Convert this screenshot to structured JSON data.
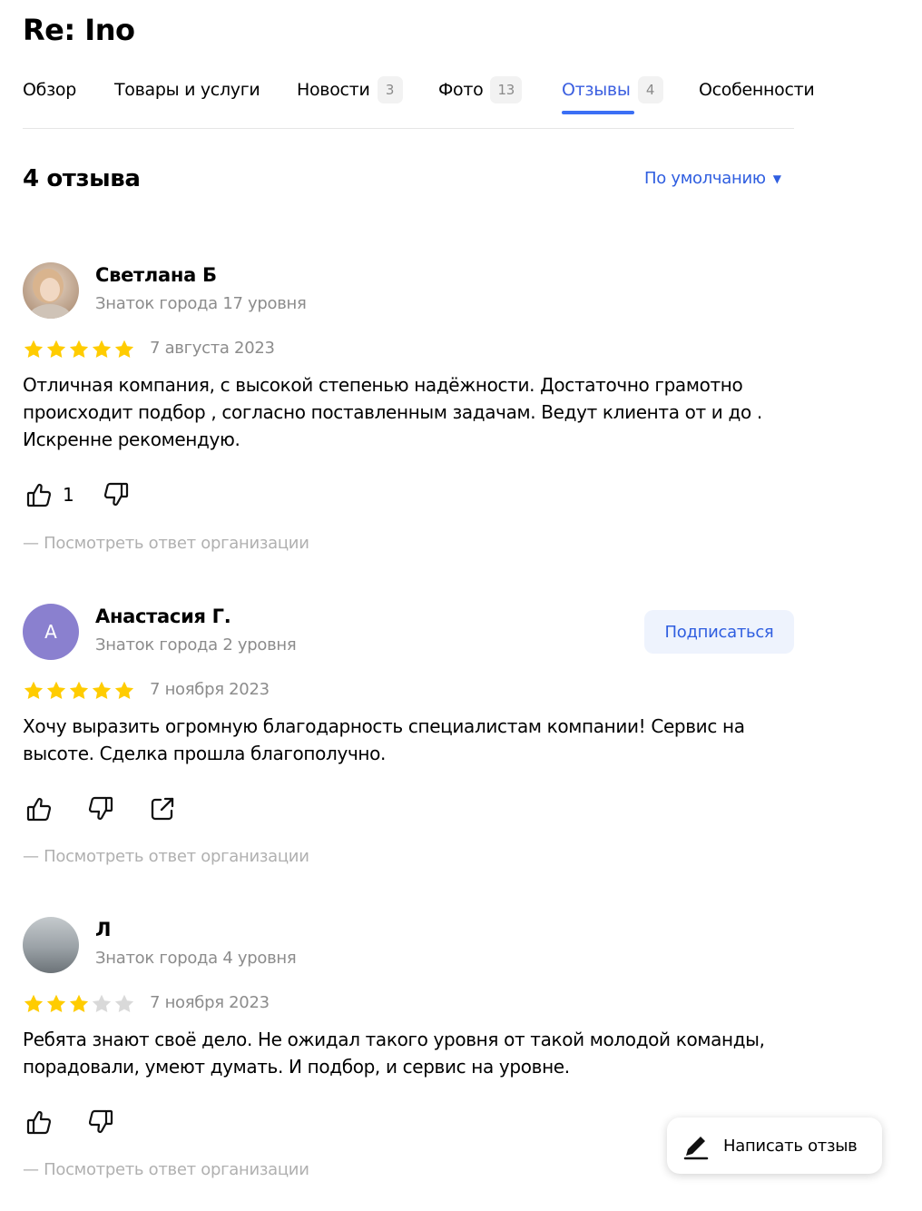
{
  "page": {
    "title": "Re: Ino"
  },
  "tabs": [
    {
      "label": "Обзор",
      "count": ""
    },
    {
      "label": "Товары и услуги",
      "count": ""
    },
    {
      "label": "Новости",
      "count": "3"
    },
    {
      "label": "Фото",
      "count": "13"
    },
    {
      "label": "Отзывы",
      "count": "4"
    },
    {
      "label": "Особенности",
      "count": ""
    }
  ],
  "active_tab": "Отзывы",
  "summary": {
    "count_text": "4 отзыва",
    "sort_label": "По умолчанию"
  },
  "reviews": [
    {
      "author": "Светлана Б",
      "level": "Знаток города 17 уровня",
      "rating": 5,
      "date": "7 августа 2023",
      "text": "Отличная компания, с высокой степенью надёжности. Достаточно грамотно происходит подбор , согласно поставленным задачам. Ведут клиента от и до . Искренне рекомендую.",
      "likes": "1",
      "org_reply": "— Посмотреть ответ организации"
    },
    {
      "author": "Анастасия Г.",
      "avatar_letter": "А",
      "level": "Знаток города 2 уровня",
      "rating": 5,
      "date": "7 ноября 2023",
      "text": "Хочу выразить огромную благодарность специалистам компании! Сервис на высоте. Сделка прошла благополучно.",
      "subscribe_label": "Подписаться",
      "org_reply": "— Посмотреть ответ организации"
    },
    {
      "author": "Л",
      "level": "Знаток города 4 уровня",
      "rating": 3,
      "date": "7 ноября 2023",
      "text": "Ребята знают своё дело. Не ожидал такого уровня от такой молодой команды, порадовали, умеют думать. И подбор, и сервис на уровне.",
      "org_reply": "— Посмотреть ответ организации"
    }
  ],
  "write_review_label": "Написать отзыв",
  "colors": {
    "accent": "#3b6ff5",
    "star": "#ffcc00",
    "star_empty": "#d9d9d9",
    "muted": "#8c8c8c"
  }
}
